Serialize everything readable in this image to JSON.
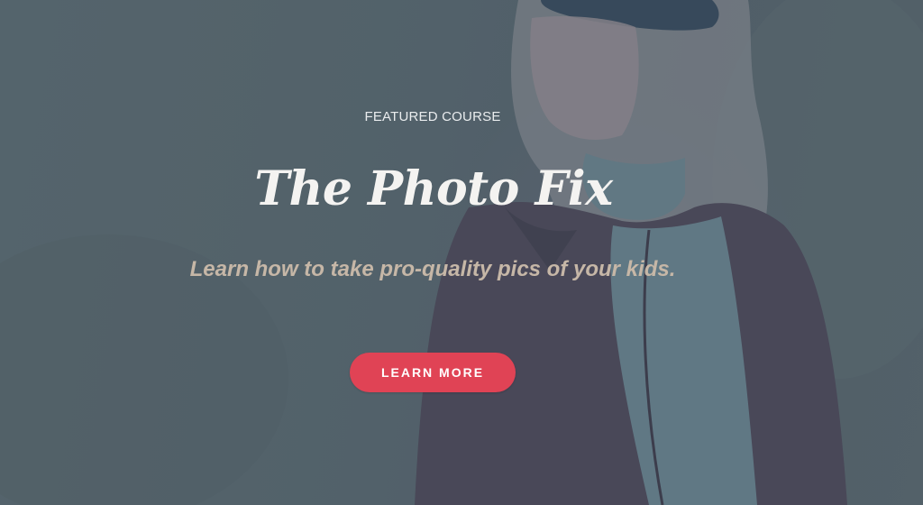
{
  "hero": {
    "eyebrow": "FEATURED COURSE",
    "title": "The Photo Fix",
    "subtitle": "Learn how to take pro-quality pics of your kids.",
    "cta_label": "LEARN MORE"
  },
  "colors": {
    "accent": "#e04355",
    "subtitle": "#c6b7a7",
    "overlay": "#55636c"
  }
}
